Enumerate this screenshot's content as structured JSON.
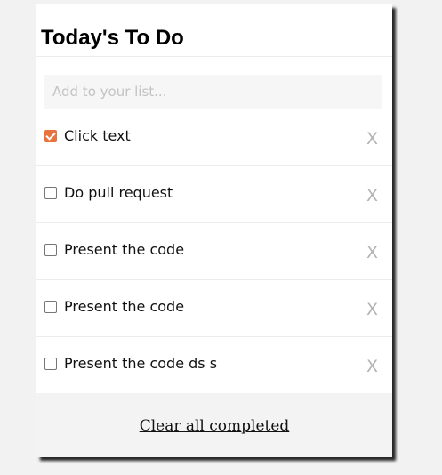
{
  "header": {
    "title": "Today's To Do"
  },
  "add_input": {
    "placeholder": "Add to your list...",
    "value": ""
  },
  "todos": [
    {
      "text": "Click text",
      "completed": true,
      "delete_label": "X"
    },
    {
      "text": "Do pull request",
      "completed": false,
      "delete_label": "X"
    },
    {
      "text": "Present the code",
      "completed": false,
      "delete_label": "X"
    },
    {
      "text": "Present the code",
      "completed": false,
      "delete_label": "X"
    },
    {
      "text": "Present the code ds s",
      "completed": false,
      "delete_label": "X"
    }
  ],
  "footer": {
    "clear_label": "Clear all completed"
  },
  "colors": {
    "accent": "#e8733f",
    "background": "#f2f2f2",
    "card": "#ffffff",
    "footer": "#f3f3f3",
    "delete": "#b3b3b3"
  }
}
